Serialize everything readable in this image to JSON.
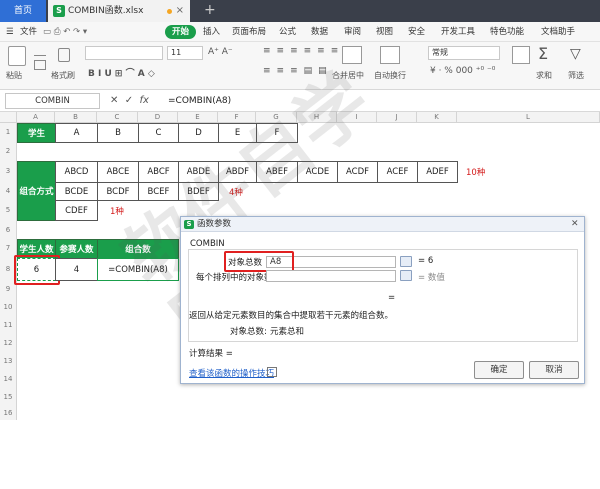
{
  "tabs": {
    "home": "首页",
    "file": "COMBIN函数.xlsx",
    "add": "+"
  },
  "menu": {
    "file": "文件",
    "start": "开始",
    "items": [
      "插入",
      "页面布局",
      "公式",
      "数据",
      "审阅",
      "视图",
      "安全",
      "开发工具",
      "特色功能",
      "文档助手"
    ]
  },
  "toolbar": {
    "paste": "粘贴",
    "cut": "剪切",
    "format_painter": "格式刷",
    "font_size": "11",
    "number_format": "常规",
    "merge_center": "合并居中",
    "auto_wrap": "自动换行",
    "sum": "求和",
    "filter": "筛选"
  },
  "formula_bar": {
    "name_box": "COMBIN",
    "cancel_icon": "✕",
    "confirm_icon": "✓",
    "fx": "fx",
    "formula": "=COMBIN(A8)"
  },
  "columns": [
    "A",
    "B",
    "C",
    "D",
    "E",
    "F",
    "G",
    "H",
    "I",
    "J",
    "K",
    "L"
  ],
  "rows": [
    "1",
    "2",
    "3",
    "4",
    "5",
    "6",
    "7",
    "8",
    "9",
    "10",
    "11",
    "12",
    "13",
    "14",
    "15",
    "16"
  ],
  "sheet": {
    "row1": {
      "label": "学生",
      "cells": [
        "A",
        "B",
        "C",
        "D",
        "E",
        "F"
      ]
    },
    "combo_label": "组合方式",
    "combos_row1": [
      "ABCD",
      "ABCE",
      "ABCF",
      "ABDE",
      "ABDF",
      "ABEF",
      "ACDE",
      "ACDF",
      "ACEF",
      "ADEF"
    ],
    "combos_row1_note": "10种",
    "combos_row2": [
      "BCDE",
      "BCDF",
      "BCEF",
      "BDEF"
    ],
    "combos_row2_note": "4种",
    "combos_row3": [
      "CDEF"
    ],
    "combos_row3_note": "1种",
    "header_students": "学生人数",
    "header_participants": "参赛人数",
    "header_combinations": "组合数",
    "val_students": "6",
    "val_participants": "4",
    "val_formula": "=COMBIN(A8)"
  },
  "dialog": {
    "title": "函数参数",
    "close": "✕",
    "function_name": "COMBIN",
    "arg1_label": "对象总数",
    "arg1_value": "A8",
    "arg1_result": "= 6",
    "arg2_label": "每个排列中的对象数",
    "arg2_result": "= 数值",
    "eq": "=",
    "description": "返回从给定元素数目的集合中提取若干元素的组合数。",
    "arg_desc_label": "对象总数:",
    "arg_desc_text": "元素总和",
    "calc_result": "计算结果 =",
    "help_link": "查看该函数的操作技巧",
    "ok": "确定",
    "cancel": "取消"
  },
  "colors": {
    "green": "#1a9e4b",
    "red": "#d31b1b",
    "tab_bar": "#3a3f4a",
    "home_tab": "#2f6fd6"
  }
}
